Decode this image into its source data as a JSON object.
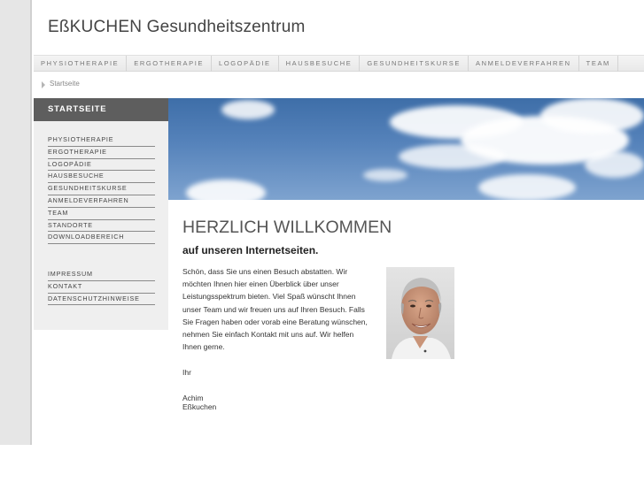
{
  "site": {
    "title": "EßKUCHEN Gesundheitszentrum"
  },
  "topnav": [
    "PHYSIOTHERAPIE",
    "ERGOTHERAPIE",
    "LOGOPÄDIE",
    "HAUSBESUCHE",
    "GESUNDHEITSKURSE",
    "ANMELDEVERFAHREN",
    "TEAM"
  ],
  "breadcrumb": {
    "current": "Startseite"
  },
  "sidebar": {
    "heading": "STARTSEITE",
    "items": [
      "PHYSIOTHERAPIE",
      "ERGOTHERAPIE",
      "LOGOPÄDIE",
      "HAUSBESUCHE",
      "GESUNDHEITSKURSE",
      "ANMELDEVERFAHREN",
      "TEAM",
      "STANDORTE",
      "DOWNLOADBEREICH"
    ],
    "secondary": [
      "IMPRESSUM",
      "KONTAKT",
      "DATENSCHUTZHINWEISE"
    ]
  },
  "main": {
    "heading": "HERZLICH WILLKOMMEN",
    "subheading": "auf unseren Internetseiten.",
    "paragraph": "Schön, dass Sie uns einen Besuch abstatten. Wir möchten Ihnen hier einen Überblick über unser Leistungsspektrum bieten. Viel Spaß wünscht Ihnen unser Team und wir freuen uns auf Ihren Besuch. Falls Sie Fragen haben oder vorab eine Beratung wünschen, nehmen Sie einfach Kontakt mit uns auf. Wir helfen Ihnen gerne.",
    "greeting": "Ihr",
    "signature": "Achim Eßkuchen"
  },
  "icons": {
    "breadcrumb_arrow": "triangle-right-icon"
  },
  "colors": {
    "sidebar_heading_bg": "#5e5e5e",
    "sidebar_bg": "#efefef",
    "sky": "#4a78b2"
  }
}
